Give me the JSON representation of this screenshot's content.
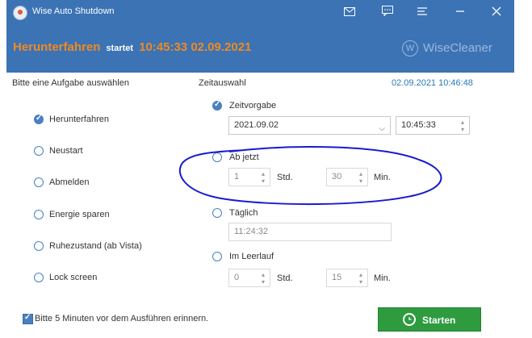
{
  "titlebar": {
    "title": "Wise Auto Shutdown",
    "icons": [
      "mail-icon",
      "feedback-icon",
      "menu-icon",
      "minimize-icon",
      "close-icon"
    ]
  },
  "status": {
    "action": "Herunterfahren",
    "verb": "startet",
    "datetime": "10:45:33 02.09.2021",
    "brand": "WiseCleaner"
  },
  "left": {
    "heading": "Bitte eine Aufgabe auswählen",
    "options": [
      "Herunterfahren",
      "Neustart",
      "Abmelden",
      "Energie sparen",
      "Ruhezustand (ab Vista)",
      "Lock screen"
    ],
    "selected_index": 0
  },
  "right": {
    "heading": "Zeitauswahl",
    "current_datetime": "02.09.2021 10:46:48",
    "zeitvorgabe": {
      "label": "Zeitvorgabe",
      "date": "2021.09.02",
      "time": "10:45:33"
    },
    "ab_jetzt": {
      "label": "Ab jetzt",
      "hours": "1",
      "hours_unit": "Std.",
      "minutes": "30",
      "minutes_unit": "Min."
    },
    "taeglich": {
      "label": "Täglich",
      "time": "11:24:32"
    },
    "leerlauf": {
      "label": "Im Leerlauf",
      "hours": "0",
      "hours_unit": "Std.",
      "minutes": "15",
      "minutes_unit": "Min."
    }
  },
  "footer": {
    "reminder_label": "Bitte 5 Minuten vor dem Ausführen erinnern.",
    "reminder_checked": true,
    "start_label": "Starten"
  },
  "colors": {
    "header": "#3b73b5",
    "accent": "#f08a20",
    "start": "#2e9b3f",
    "annotation": "#1a1acf"
  }
}
